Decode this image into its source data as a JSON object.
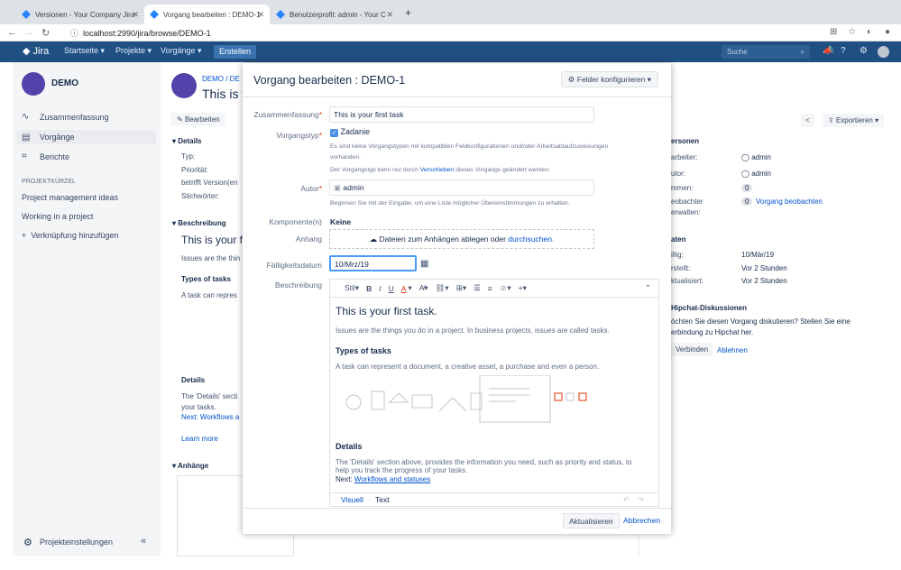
{
  "browser": {
    "tabs": [
      {
        "title": "Versionen - Your Company Jira"
      },
      {
        "title": "Vorgang bearbeiten : DEMO-1"
      },
      {
        "title": "Benutzerprofil: admin - Your C"
      }
    ],
    "url": "localhost:2990/jira/browse/DEMO-1"
  },
  "header": {
    "logo": "Jira",
    "nav": [
      "Startseite",
      "Projekte",
      "Vorgänge"
    ],
    "create": "Erstellen",
    "search_placeholder": "Suche"
  },
  "sidebar": {
    "project": "DEMO",
    "items": [
      "Zusammenfassung",
      "Vorgänge",
      "Berichte"
    ],
    "shortcuts_label": "PROJEKTKÜRZEL",
    "shortcuts": [
      "Project management ideas",
      "Working in a project"
    ],
    "add_link": "Verknüpfung hinzufügen",
    "settings": "Projekteinstellungen"
  },
  "background": {
    "breadcrumb": "DEMO / DE",
    "title": "This is y",
    "edit_btn": "Bearbeiten",
    "details": "Details",
    "fields": [
      "Typ:",
      "Priorität:",
      "betrifft Version(en",
      "Stichwörter:"
    ],
    "description": "Beschreibung",
    "desc_title": "This is your fir",
    "desc_text": "Issues are the thin",
    "types": "Types of tasks",
    "types_text": "A task can repres",
    "details2": "Details",
    "details2_text": "The 'Details' secti",
    "details2_text2": "your tasks.",
    "next": "Next: Workflows a",
    "learn": "Learn more",
    "attachments": "Anhänge",
    "export": "Exportieren",
    "people": "ersonen",
    "people_rows": [
      [
        "arbeiter:",
        "admin"
      ],
      [
        "utor:",
        "admin"
      ],
      [
        "mmen:",
        "0"
      ],
      [
        "eobachter",
        "0"
      ]
    ],
    "watch": "Vorgang beobachten",
    "manage": "erwalten:",
    "dates": "aten",
    "date_rows": [
      [
        "illig:",
        "10/Mär/19"
      ],
      [
        "rstellt:",
        "Vor 2 Stunden"
      ],
      [
        "ktualisiert:",
        "Vor 2 Stunden"
      ]
    ],
    "hipchat": "Hipchat-Diskussionen",
    "hipchat_text": "öchten Sie diesen Vorgang diskutieren? Stellen Sie eine",
    "hipchat_text2": "erbindung zu Hipchat her.",
    "connect": "Verbinden",
    "decline": "Ablehnen"
  },
  "modal": {
    "title": "Vorgang bearbeiten : DEMO-1",
    "configure": "Felder konfigurieren",
    "summary_label": "Zusammenfassung",
    "summary_value": "This is your first task",
    "type_label": "Vorgangstyp",
    "type_value": "Zadanie",
    "type_hint1": "Es sind keine Vorgangstypen mit kompatiblen Feldkonfigurationen und/oder Arbeitsablaufzuweisungen",
    "type_hint2": "vorhanden.",
    "type_hint3a": "Der Vorgangstyp kann nur durch",
    "type_hint3_link": "Verschieben",
    "type_hint3b": "dieses Vorgangs geändert werden.",
    "author_label": "Autor",
    "author_value": "admin",
    "author_hint": "Beginnen Sie mit der Eingabe, um eine Liste möglicher Übereinstimmungen zu erhalten.",
    "component_label": "Komponente(n)",
    "component_value": "Keine",
    "attach_label": "Anhang",
    "attach_text": "Dateien zum Anhängen ablegen oder",
    "attach_link": "durchsuchen.",
    "due_label": "Fälligkeitsdatum",
    "due_value": "10/Mrz/19",
    "desc_label": "Beschreibung",
    "toolbar": {
      "style": "Stil"
    },
    "content": {
      "h1": "This is your first task.",
      "p1": "Issues are the things you do in a project. In business projects, issues are called tasks.",
      "h2": "Types of tasks",
      "p2": "A task can represent a document, a creative asset, a purchase and even a person.",
      "h3": "Details",
      "p3": "The 'Details' section above, provides the information you need, such as priority and status, to",
      "p3b": "help you track the progress of your tasks.",
      "next_prefix": "Next:",
      "next_link": "Workflows and statuses"
    },
    "tab_visual": "Visuell",
    "tab_text": "Text",
    "update": "Aktualisieren",
    "cancel": "Abbrechen"
  },
  "colors": {
    "jira_blue": "#205081",
    "link": "#0052cc"
  }
}
